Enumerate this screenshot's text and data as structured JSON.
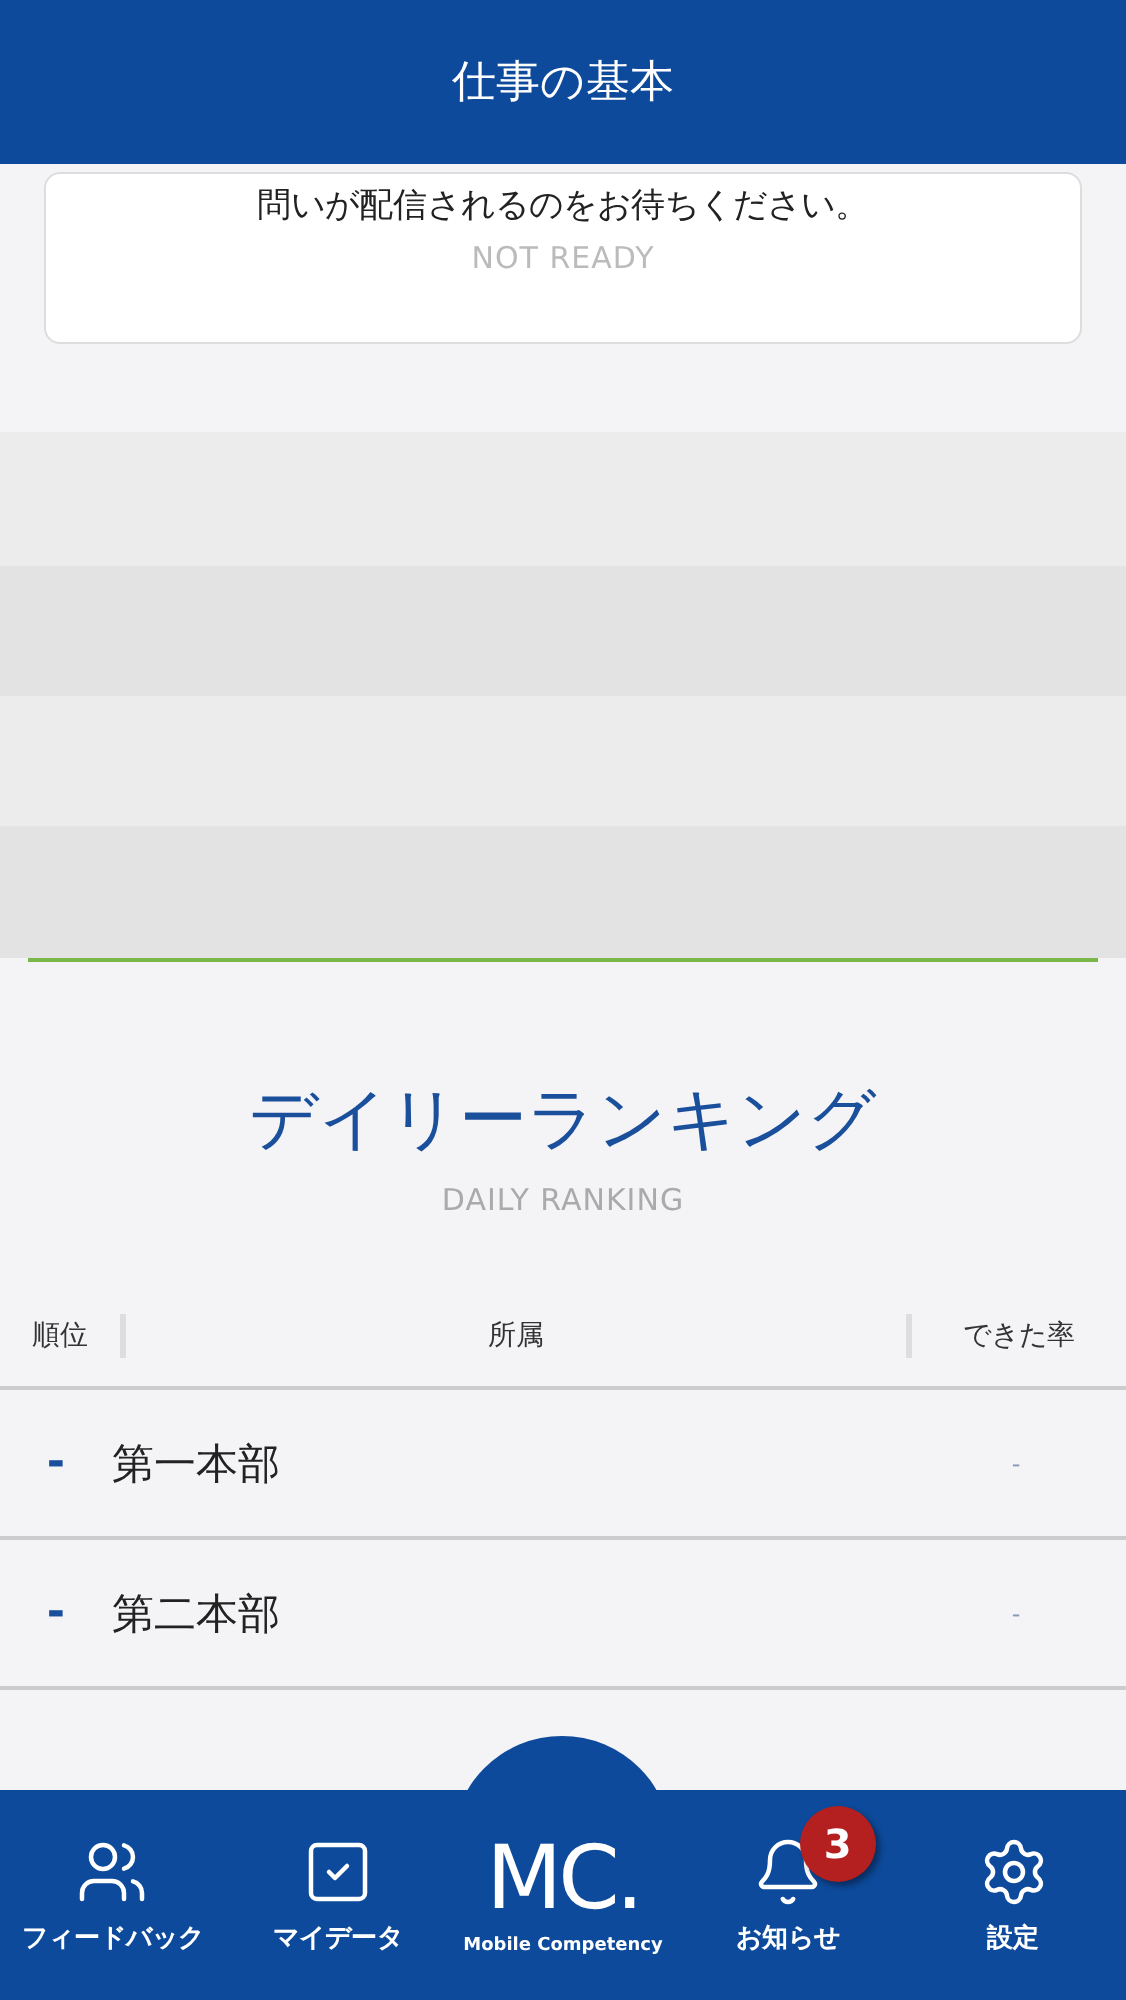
{
  "header": {
    "title": "仕事の基本"
  },
  "question_card": {
    "message": "問いが配信されるのをお待ちください。",
    "status": "NOT READY"
  },
  "ranking": {
    "title": "デイリーランキング",
    "subtitle": "DAILY RANKING",
    "columns": [
      "順位",
      "所属",
      "できた率"
    ],
    "rows": [
      {
        "rank": "-",
        "name": "第一本部",
        "rate": "-"
      },
      {
        "rank": "-",
        "name": "第二本部",
        "rate": "-"
      }
    ]
  },
  "nav": [
    {
      "kind": "people",
      "label": "フィードバック"
    },
    {
      "kind": "check",
      "label": "マイデータ"
    },
    {
      "kind": "logo",
      "label": "MC.",
      "sublabel": "Mobile Competency"
    },
    {
      "kind": "bell",
      "label": "お知らせ",
      "badge": "3"
    },
    {
      "kind": "gear",
      "label": "設定"
    }
  ]
}
